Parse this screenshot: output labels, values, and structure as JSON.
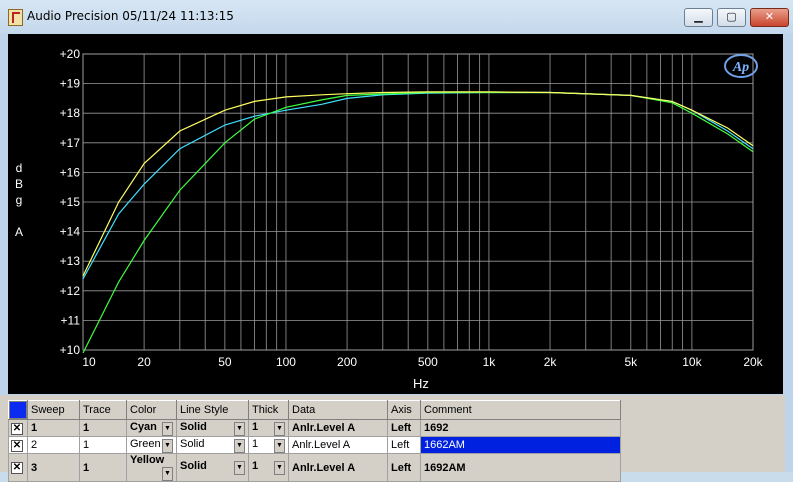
{
  "window": {
    "title": "Audio Precision  05/11/24 11:13:15",
    "controls": {
      "minimize": "▁",
      "maximize": "▢",
      "close": "✕"
    }
  },
  "chart": {
    "ylabel_chars": [
      "d",
      "B",
      "g",
      "",
      "A"
    ],
    "xlabel": "Hz",
    "yticks": [
      "+20",
      "+19",
      "+18",
      "+17",
      "+16",
      "+15",
      "+14",
      "+13",
      "+12",
      "+11",
      "+10"
    ],
    "xticks": [
      "10",
      "20",
      "50",
      "100",
      "200",
      "500",
      "1k",
      "2k",
      "5k",
      "10k",
      "20k"
    ],
    "logo": "Ap"
  },
  "chart_data": {
    "type": "line",
    "xscale": "log",
    "xlim": [
      10,
      20000
    ],
    "ylim": [
      10,
      20
    ],
    "xlabel": "Hz",
    "ylabel": "dBg A",
    "grid": true,
    "series": [
      {
        "name": "1692",
        "color": "#40e0ff",
        "x": [
          10,
          15,
          20,
          30,
          50,
          70,
          100,
          150,
          200,
          300,
          500,
          1000,
          2000,
          5000,
          8000,
          10000,
          15000,
          20000
        ],
        "y": [
          12.4,
          14.6,
          15.6,
          16.8,
          17.6,
          17.9,
          18.1,
          18.3,
          18.5,
          18.62,
          18.68,
          18.7,
          18.7,
          18.6,
          18.4,
          18.1,
          17.4,
          16.8
        ]
      },
      {
        "name": "1662AM",
        "color": "#40ff40",
        "x": [
          10,
          15,
          20,
          30,
          50,
          70,
          100,
          150,
          200,
          300,
          500,
          1000,
          2000,
          5000,
          8000,
          10000,
          15000,
          20000
        ],
        "y": [
          9.9,
          12.3,
          13.7,
          15.4,
          17.0,
          17.8,
          18.2,
          18.45,
          18.6,
          18.65,
          18.7,
          18.7,
          18.7,
          18.6,
          18.35,
          18.0,
          17.3,
          16.7
        ]
      },
      {
        "name": "1692AM",
        "color": "#ffff60",
        "x": [
          10,
          15,
          20,
          30,
          50,
          70,
          100,
          150,
          200,
          300,
          500,
          1000,
          2000,
          5000,
          8000,
          10000,
          15000,
          20000
        ],
        "y": [
          12.5,
          15.0,
          16.3,
          17.4,
          18.1,
          18.4,
          18.55,
          18.62,
          18.66,
          18.7,
          18.72,
          18.72,
          18.7,
          18.6,
          18.4,
          18.1,
          17.5,
          16.9
        ]
      }
    ]
  },
  "table": {
    "headers": [
      "Sweep",
      "Trace",
      "Color",
      "Line Style",
      "Thick",
      "Data",
      "Axis",
      "Comment"
    ],
    "rows": [
      {
        "sweep": "1",
        "trace": "1",
        "color": "Cyan",
        "style": "Solid",
        "thick": "1",
        "data": "Anlr.Level A",
        "axis": "Left",
        "comment": "1692"
      },
      {
        "sweep": "2",
        "trace": "1",
        "color": "Green",
        "style": "Solid",
        "thick": "1",
        "data": "Anlr.Level A",
        "axis": "Left",
        "comment": "1662AM"
      },
      {
        "sweep": "3",
        "trace": "1",
        "color": "Yellow",
        "style": "Solid",
        "thick": "1",
        "data": "Anlr.Level A",
        "axis": "Left",
        "comment": "1692AM"
      }
    ],
    "checkbox_mark": "✕",
    "dropdown_glyph": "▼"
  }
}
